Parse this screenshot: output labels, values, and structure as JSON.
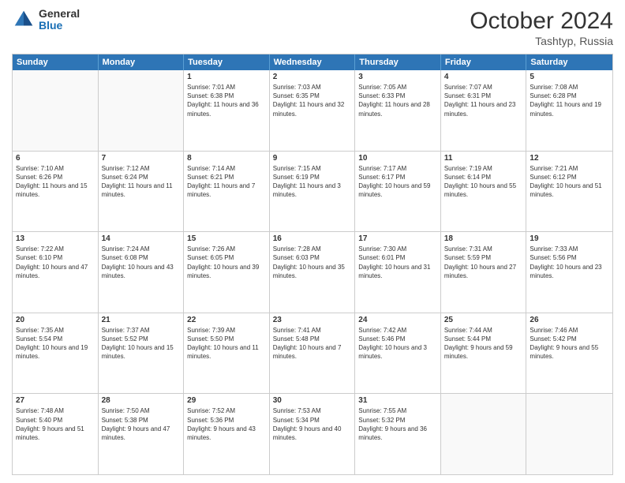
{
  "logo": {
    "general": "General",
    "blue": "Blue"
  },
  "header": {
    "month": "October 2024",
    "location": "Tashtyp, Russia"
  },
  "days": [
    "Sunday",
    "Monday",
    "Tuesday",
    "Wednesday",
    "Thursday",
    "Friday",
    "Saturday"
  ],
  "weeks": [
    [
      {
        "day": "",
        "content": ""
      },
      {
        "day": "",
        "content": ""
      },
      {
        "day": "1",
        "content": "Sunrise: 7:01 AM\nSunset: 6:38 PM\nDaylight: 11 hours and 36 minutes."
      },
      {
        "day": "2",
        "content": "Sunrise: 7:03 AM\nSunset: 6:35 PM\nDaylight: 11 hours and 32 minutes."
      },
      {
        "day": "3",
        "content": "Sunrise: 7:05 AM\nSunset: 6:33 PM\nDaylight: 11 hours and 28 minutes."
      },
      {
        "day": "4",
        "content": "Sunrise: 7:07 AM\nSunset: 6:31 PM\nDaylight: 11 hours and 23 minutes."
      },
      {
        "day": "5",
        "content": "Sunrise: 7:08 AM\nSunset: 6:28 PM\nDaylight: 11 hours and 19 minutes."
      }
    ],
    [
      {
        "day": "6",
        "content": "Sunrise: 7:10 AM\nSunset: 6:26 PM\nDaylight: 11 hours and 15 minutes."
      },
      {
        "day": "7",
        "content": "Sunrise: 7:12 AM\nSunset: 6:24 PM\nDaylight: 11 hours and 11 minutes."
      },
      {
        "day": "8",
        "content": "Sunrise: 7:14 AM\nSunset: 6:21 PM\nDaylight: 11 hours and 7 minutes."
      },
      {
        "day": "9",
        "content": "Sunrise: 7:15 AM\nSunset: 6:19 PM\nDaylight: 11 hours and 3 minutes."
      },
      {
        "day": "10",
        "content": "Sunrise: 7:17 AM\nSunset: 6:17 PM\nDaylight: 10 hours and 59 minutes."
      },
      {
        "day": "11",
        "content": "Sunrise: 7:19 AM\nSunset: 6:14 PM\nDaylight: 10 hours and 55 minutes."
      },
      {
        "day": "12",
        "content": "Sunrise: 7:21 AM\nSunset: 6:12 PM\nDaylight: 10 hours and 51 minutes."
      }
    ],
    [
      {
        "day": "13",
        "content": "Sunrise: 7:22 AM\nSunset: 6:10 PM\nDaylight: 10 hours and 47 minutes."
      },
      {
        "day": "14",
        "content": "Sunrise: 7:24 AM\nSunset: 6:08 PM\nDaylight: 10 hours and 43 minutes."
      },
      {
        "day": "15",
        "content": "Sunrise: 7:26 AM\nSunset: 6:05 PM\nDaylight: 10 hours and 39 minutes."
      },
      {
        "day": "16",
        "content": "Sunrise: 7:28 AM\nSunset: 6:03 PM\nDaylight: 10 hours and 35 minutes."
      },
      {
        "day": "17",
        "content": "Sunrise: 7:30 AM\nSunset: 6:01 PM\nDaylight: 10 hours and 31 minutes."
      },
      {
        "day": "18",
        "content": "Sunrise: 7:31 AM\nSunset: 5:59 PM\nDaylight: 10 hours and 27 minutes."
      },
      {
        "day": "19",
        "content": "Sunrise: 7:33 AM\nSunset: 5:56 PM\nDaylight: 10 hours and 23 minutes."
      }
    ],
    [
      {
        "day": "20",
        "content": "Sunrise: 7:35 AM\nSunset: 5:54 PM\nDaylight: 10 hours and 19 minutes."
      },
      {
        "day": "21",
        "content": "Sunrise: 7:37 AM\nSunset: 5:52 PM\nDaylight: 10 hours and 15 minutes."
      },
      {
        "day": "22",
        "content": "Sunrise: 7:39 AM\nSunset: 5:50 PM\nDaylight: 10 hours and 11 minutes."
      },
      {
        "day": "23",
        "content": "Sunrise: 7:41 AM\nSunset: 5:48 PM\nDaylight: 10 hours and 7 minutes."
      },
      {
        "day": "24",
        "content": "Sunrise: 7:42 AM\nSunset: 5:46 PM\nDaylight: 10 hours and 3 minutes."
      },
      {
        "day": "25",
        "content": "Sunrise: 7:44 AM\nSunset: 5:44 PM\nDaylight: 9 hours and 59 minutes."
      },
      {
        "day": "26",
        "content": "Sunrise: 7:46 AM\nSunset: 5:42 PM\nDaylight: 9 hours and 55 minutes."
      }
    ],
    [
      {
        "day": "27",
        "content": "Sunrise: 7:48 AM\nSunset: 5:40 PM\nDaylight: 9 hours and 51 minutes."
      },
      {
        "day": "28",
        "content": "Sunrise: 7:50 AM\nSunset: 5:38 PM\nDaylight: 9 hours and 47 minutes."
      },
      {
        "day": "29",
        "content": "Sunrise: 7:52 AM\nSunset: 5:36 PM\nDaylight: 9 hours and 43 minutes."
      },
      {
        "day": "30",
        "content": "Sunrise: 7:53 AM\nSunset: 5:34 PM\nDaylight: 9 hours and 40 minutes."
      },
      {
        "day": "31",
        "content": "Sunrise: 7:55 AM\nSunset: 5:32 PM\nDaylight: 9 hours and 36 minutes."
      },
      {
        "day": "",
        "content": ""
      },
      {
        "day": "",
        "content": ""
      }
    ]
  ]
}
